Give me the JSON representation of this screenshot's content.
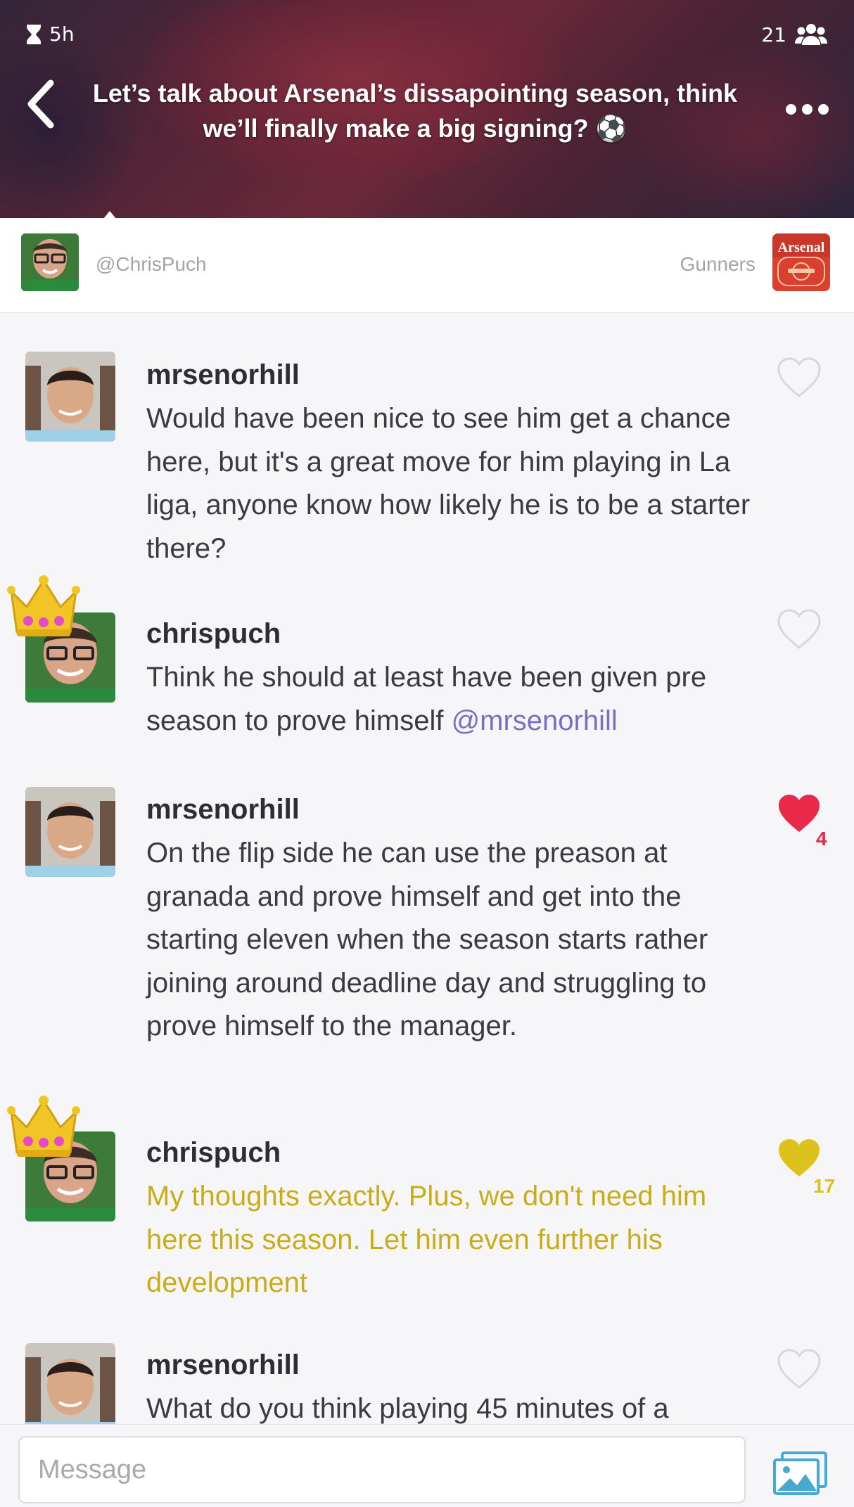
{
  "header": {
    "time_remaining": "5h",
    "member_count": "21",
    "title": "Let’s talk about Arsenal’s dissapointing season, think we’ll finally make a big signing? ⚽"
  },
  "group_bar": {
    "creator_handle": "@ChrisPuch",
    "group_name": "Gunners",
    "badge_text": "Arsenal"
  },
  "messages": [
    {
      "username": "mrsenorhill",
      "text": "Would have been nice to see him get a chance here, but it's a great move for him playing in La liga, anyone know how likely he is to be a starter there?",
      "liked": false
    },
    {
      "username": "chrispuch",
      "text": "Think he should at least have been given pre season to prove himself ",
      "mention": "@mrsenorhill",
      "liked": false
    },
    {
      "username": "mrsenorhill",
      "text": "On the flip side he can use the preason at granada and prove himself and get into the starting eleven when the season starts rather joining around deadline day and struggling to prove himself to the manager.",
      "liked": true,
      "like_count": "4"
    },
    {
      "username": "chrispuch",
      "text": "My thoughts exactly. Plus, we don't need him here this season. Let him even further his development",
      "liked": true,
      "like_count": "17"
    },
    {
      "username": "mrsenorhill",
      "text": "What do you think playing 45 minutes of a",
      "liked": false
    }
  ],
  "composer": {
    "placeholder": "Message"
  },
  "colors": {
    "like_red": "#e8294a",
    "like_gold": "#dcc21a",
    "mention_purple": "#7d6cc2",
    "highlight_text": "#c9ad18"
  }
}
